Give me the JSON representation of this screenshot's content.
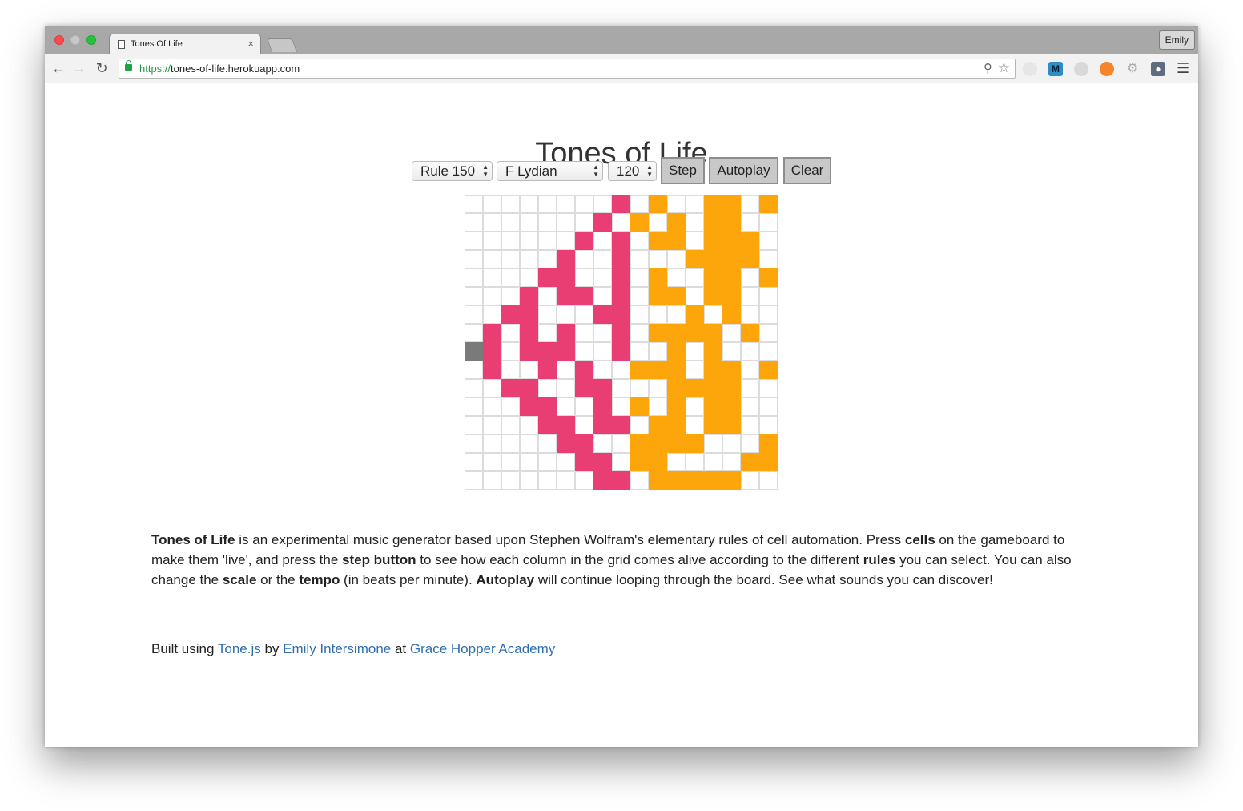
{
  "browser": {
    "tab_title": "Tones Of Life",
    "tab_close": "×",
    "profile_name": "Emily",
    "url_scheme": "https://",
    "url_rest": "tones-of-life.herokuapp.com",
    "icons": [
      "back-arrow-icon",
      "forward-arrow-icon",
      "reload-icon",
      "lock-icon",
      "zoom-icon",
      "star-icon",
      "menu-icon"
    ]
  },
  "page": {
    "title": "Tones of Life",
    "controls": {
      "rule_selected": "Rule 150",
      "scale_selected": "F Lydian",
      "tempo_selected": "120",
      "step_label": "Step",
      "autoplay_label": "Autoplay",
      "clear_label": "Clear"
    },
    "board": {
      "columns": 17,
      "rows": 16,
      "colors": {
        "rule": "#e83e73",
        "live": "#fca60b",
        "current": "#7a7a7a"
      },
      "grid": [
        "........p.o..oo.oo",
        ".......p.o.o.oo...",
        "......p.p.oo.ooo..",
        ".....p..p...oooo..",
        "....pp..p.o..oo.o.",
        "...p.pp.p.oo.oo...",
        "..pp...pp...o.o...",
        ".p.p.p..p.oooo.o..",
        "gp.ppp..p..o.o....",
        ".p..p.p..ooo.oo.o.",
        "..pp..pp...oooo...",
        "...pp..p.o.o.oo...",
        "....pp.pp.oo.oo...",
        ".....pp..oooo...o.",
        "......pp.oo....oo.",
        ".......pp.ooooo..."
      ]
    },
    "description": {
      "b1": "Tones of Life",
      "t1": " is an experimental music generator based upon Stephen Wolfram's elementary rules of cell automation. Press ",
      "b2": "cells",
      "t2": " on the gameboard to make them 'live', and press the ",
      "b3": "step button",
      "t3": " to see how each column in the grid comes alive according to the different ",
      "b4": "rules",
      "t4": " you can select. You can also change the ",
      "b5": "scale",
      "t5": " or the ",
      "b6": "tempo",
      "t6": " (in beats per minute). ",
      "b7": "Autoplay",
      "t7": " will continue looping through the board. See what sounds you can discover!"
    },
    "footer": {
      "built_using": "Built using ",
      "tone_link": "Tone.js",
      "by": " by ",
      "author_link": "Emily Intersimone",
      "at": " at ",
      "school_link": "Grace Hopper Academy"
    }
  }
}
